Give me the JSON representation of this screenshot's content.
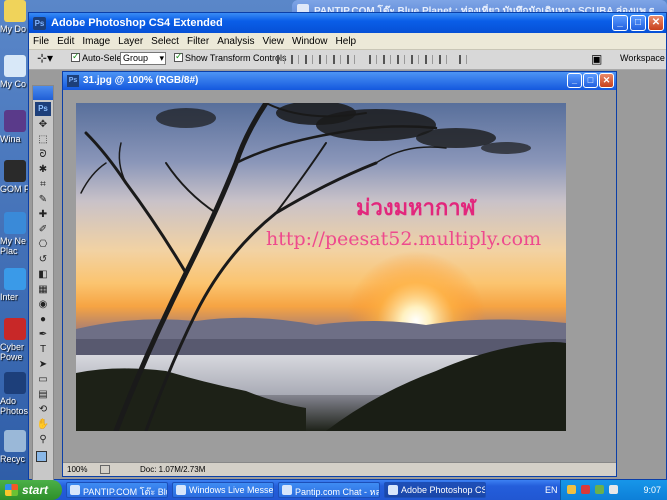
{
  "desktop": {
    "icons": [
      {
        "label": "My Do",
        "color": "#f0d35a"
      },
      {
        "label": "My Co",
        "color": "#d8e8f8"
      },
      {
        "label": "Wina",
        "color": "#5a3a8a"
      },
      {
        "label": "GOM F",
        "color": "#2a2a2a"
      },
      {
        "label": "My Ne Plac",
        "color": "#3a8ad8"
      },
      {
        "label": "Inter",
        "color": "#3a9ae8"
      },
      {
        "label": "Cyber Powe",
        "color": "#c82828"
      },
      {
        "label": "Ado Photosh",
        "color": "#1d3f7a"
      },
      {
        "label": "Recyc",
        "color": "#9ab8d8"
      }
    ]
  },
  "background_window": {
    "title": "PANTIP.COM โต๊ะ Blue Planet : ท่องเที่ยว บันทึกนักเดินทาง SCUBA ล่องแพ ตกปลา"
  },
  "photoshop": {
    "title": "Adobe Photoshop CS4 Extended",
    "logo": "Ps",
    "menu": [
      "File",
      "Edit",
      "Image",
      "Layer",
      "Select",
      "Filter",
      "Analysis",
      "View",
      "Window",
      "Help"
    ],
    "options": {
      "auto_select_label": "Auto-Select:",
      "auto_select_value": "Group",
      "show_transform_label": "Show Transform Controls",
      "workspace_label": "Workspace"
    },
    "window_buttons": {
      "minimize": "_",
      "maximize": "□",
      "close": "✕"
    }
  },
  "toolbox": {
    "logo": "Ps",
    "tools": [
      "move-tool",
      "marquee-tool",
      "lasso-tool",
      "magic-wand-tool",
      "crop-tool",
      "eyedropper-tool",
      "healing-brush-tool",
      "brush-tool",
      "clone-stamp-tool",
      "history-brush-tool",
      "eraser-tool",
      "gradient-tool",
      "blur-tool",
      "dodge-tool",
      "pen-tool",
      "type-tool",
      "path-selection-tool",
      "shape-tool",
      "notes-tool",
      "3d-rotate-tool",
      "hand-tool",
      "zoom-tool"
    ],
    "glyphs": [
      "✥",
      "⬚",
      "ᘐ",
      "✱",
      "⌗",
      "✎",
      "✚",
      "✐",
      "⎔",
      "↺",
      "◧",
      "▦",
      "◉",
      "●",
      "✒",
      "T",
      "➤",
      "▭",
      "▤",
      "⟲",
      "✋",
      "⚲"
    ],
    "foreground_color": "#8ab8e8"
  },
  "document": {
    "title": "31.jpg @ 100% (RGB/8#)",
    "zoom": "100%",
    "doc_info": "Doc: 1.07M/2.73M",
    "watermark_thai": "ม่วงมหากาฬ",
    "watermark_url": "http://peesat52.multiply.com"
  },
  "taskbar": {
    "start_label": "start",
    "tasks": [
      {
        "label": "PANTIP.COM โต๊ะ Blu...",
        "active": false
      },
      {
        "label": "Windows Live Messen...",
        "active": false
      },
      {
        "label": "Pantip.com Chat - หล...",
        "active": false
      },
      {
        "label": "Adobe Photoshop CS...",
        "active": true
      }
    ],
    "language": "EN",
    "clock": "9:07"
  }
}
